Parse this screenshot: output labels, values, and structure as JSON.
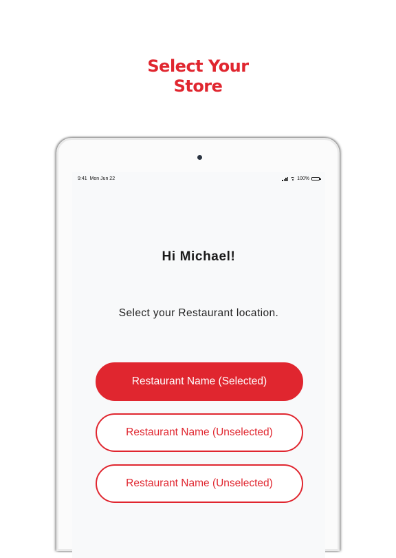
{
  "headline": {
    "line1": "Select Your",
    "line2": "Store"
  },
  "status_bar": {
    "time": "9:41",
    "date": "Mon Jun 22",
    "battery": "100%"
  },
  "greeting": "Hi Michael!",
  "prompt": "Select your Restaurant location.",
  "stores": [
    {
      "label": "Restaurant Name (Selected)",
      "selected": true
    },
    {
      "label": "Restaurant Name (Unselected)",
      "selected": false
    },
    {
      "label": "Restaurant Name (Unselected)",
      "selected": false
    }
  ],
  "colors": {
    "accent": "#e0262f",
    "text": "#1a1a1a",
    "screen_bg": "#f8f9fa"
  },
  "icons": [
    "camera-icon",
    "signal-icon",
    "wifi-icon",
    "battery-icon"
  ]
}
